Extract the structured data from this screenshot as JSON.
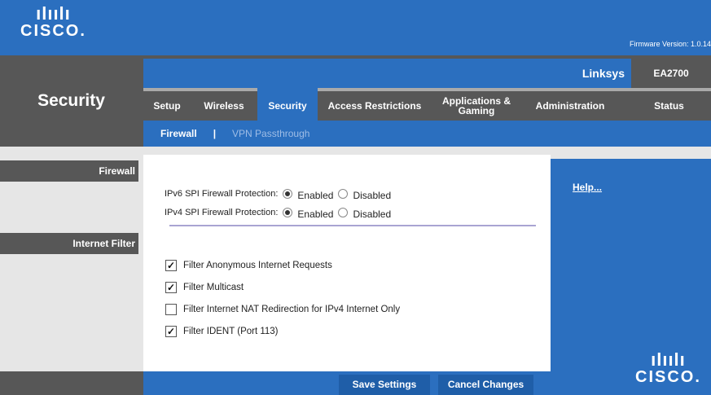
{
  "logo": {
    "bars": "ılıılı",
    "word": "CISCO."
  },
  "firmware": "Firmware Version: 1.0.14",
  "page_title": "Security",
  "brand": "Linksys",
  "model": "EA2700",
  "tabs": [
    {
      "label": "Setup"
    },
    {
      "label": "Wireless"
    },
    {
      "label": "Security"
    },
    {
      "label": "Access Restrictions"
    },
    {
      "label": "Applications & Gaming"
    },
    {
      "label": "Administration"
    },
    {
      "label": "Status"
    }
  ],
  "subnav": {
    "current": "Firewall",
    "separator": "|",
    "other": "VPN Passthrough"
  },
  "side": {
    "firewall": "Firewall",
    "internet_filter": "Internet Filter"
  },
  "firewall": {
    "ipv6_label": "IPv6 SPI Firewall Protection:",
    "ipv4_label": "IPv4 SPI Firewall Protection:",
    "enabled": "Enabled",
    "disabled": "Disabled",
    "ipv6_value": "Enabled",
    "ipv4_value": "Enabled"
  },
  "filters": [
    {
      "label": "Filter Anonymous Internet Requests",
      "checked": true
    },
    {
      "label": "Filter Multicast",
      "checked": true
    },
    {
      "label": "Filter Internet NAT Redirection for IPv4 Internet Only",
      "checked": false
    },
    {
      "label": "Filter IDENT (Port 113)",
      "checked": true
    }
  ],
  "help": "Help...",
  "buttons": {
    "save": "Save Settings",
    "cancel": "Cancel Changes"
  },
  "colors": {
    "brand_blue": "#2b6fbf",
    "dark_gray": "#575757"
  }
}
